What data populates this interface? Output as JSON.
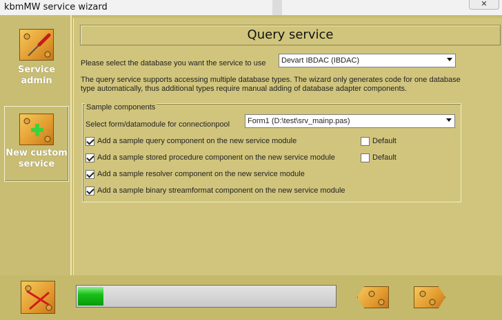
{
  "window": {
    "title": "kbmMW service wizard",
    "close_label": "✕"
  },
  "nav": {
    "items": [
      {
        "label_line1": "Service",
        "label_line2": "admin",
        "icon": "screwdriver-icon",
        "selected": false
      },
      {
        "label_line1": "New custom",
        "label_line2": "service",
        "icon": "plus-icon",
        "selected": true
      }
    ]
  },
  "main": {
    "header": "Query service",
    "db_label": "Please select the database you want the service to use",
    "db_value": "Devart IBDAC (IBDAC)",
    "description": "The query service supports accessing multiple database types. The wizard only generates code for one database type automatically, thus additional types require manual adding of database adapter components.",
    "group_label": "Sample components",
    "pool_label": "Select form/datamodule for connectionpool",
    "pool_value": "Form1 (D:\\test\\srv_mainp.pas)",
    "options": [
      {
        "label": "Add a sample query component on the new service module",
        "checked": true
      },
      {
        "label": "Add a sample stored procedure component on the new service module",
        "checked": true
      },
      {
        "label": "Add a sample resolver component on the new service module",
        "checked": true
      },
      {
        "label": "Add a sample binary streamformat component on the new service module",
        "checked": true
      }
    ],
    "default_label": "Default"
  },
  "footer": {
    "progress_percent": 10,
    "cancel_icon": "cancel-icon",
    "back_icon": "arrow-left-icon",
    "next_icon": "arrow-right-icon"
  },
  "colors": {
    "panel": "#d1c57d",
    "frame": "#c7bc6e",
    "progress_fill": "#18c018"
  }
}
